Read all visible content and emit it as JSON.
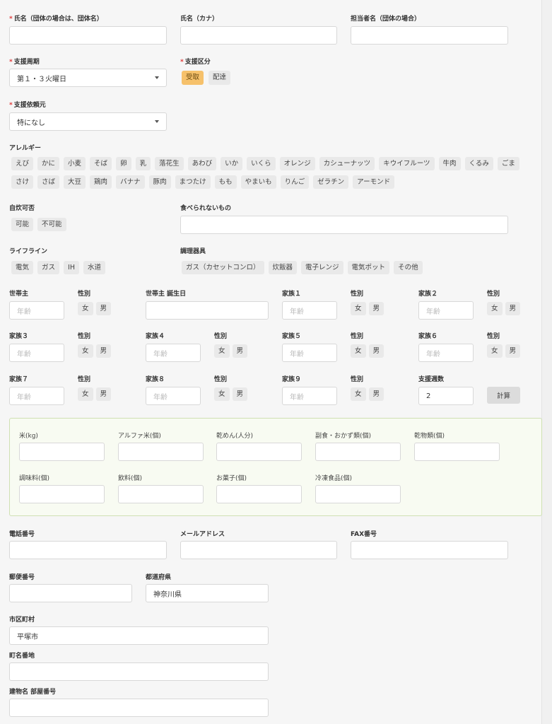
{
  "name": {
    "label": "氏名（団体の場合は、団体名）",
    "required": true,
    "value": ""
  },
  "kana": {
    "label": "氏名（カナ）",
    "value": ""
  },
  "contact": {
    "label": "担当者名（団体の場合）",
    "value": ""
  },
  "period": {
    "label": "支援周期",
    "required": true,
    "value": "第１・３火曜日"
  },
  "category": {
    "label": "支援区分",
    "required": true,
    "options": [
      "受取",
      "配達"
    ],
    "selected": "受取"
  },
  "requester": {
    "label": "支援依頼元",
    "required": true,
    "value": "特になし"
  },
  "allergy": {
    "label": "アレルギー",
    "row1": [
      "えび",
      "かに",
      "小麦",
      "そば",
      "卵",
      "乳",
      "落花生",
      "あわび",
      "いか",
      "いくら",
      "オレンジ",
      "カシューナッツ",
      "キウイフルーツ",
      "牛肉",
      "くるみ",
      "ごま"
    ],
    "row2": [
      "さけ",
      "さば",
      "大豆",
      "鶏肉",
      "バナナ",
      "豚肉",
      "まつたけ",
      "もも",
      "やまいも",
      "りんご",
      "ゼラチン",
      "アーモンド"
    ]
  },
  "selfcook": {
    "label": "自炊可否",
    "options": [
      "可能",
      "不可能"
    ]
  },
  "cannot_eat": {
    "label": "食べられないもの",
    "value": ""
  },
  "lifeline": {
    "label": "ライフライン",
    "options": [
      "電気",
      "ガス",
      "IH",
      "水道"
    ]
  },
  "utensils": {
    "label": "調理器具",
    "options": [
      "ガス（カセットコンロ）",
      "炊飯器",
      "電子レンジ",
      "電気ポット",
      "その他"
    ]
  },
  "household": {
    "age_placeholder": "年齢",
    "gender_label": "性別",
    "female": "女",
    "male": "男",
    "head": "世帯主",
    "head_birthday": "世帯主 誕生日",
    "members": [
      "家族１",
      "家族２",
      "家族３",
      "家族４",
      "家族５",
      "家族６",
      "家族７",
      "家族８",
      "家族９"
    ],
    "weeks_label": "支援週数",
    "weeks_value": "2",
    "calc_button": "計算"
  },
  "food": {
    "items": [
      "米(kg)",
      "アルファ米(個)",
      "乾めん(人分)",
      "副食・おかず類(個)",
      "乾物類(個)",
      "調味料(個)",
      "飲料(個)",
      "お菓子(個)",
      "冷凍食品(個)"
    ]
  },
  "phone": {
    "label": "電話番号",
    "value": ""
  },
  "email": {
    "label": "メールアドレス",
    "value": ""
  },
  "fax": {
    "label": "FAX番号",
    "value": ""
  },
  "postal": {
    "label": "郵便番号",
    "value": ""
  },
  "prefecture": {
    "label": "都道府県",
    "value": "神奈川県"
  },
  "city": {
    "label": "市区町村",
    "value": "平塚市"
  },
  "street": {
    "label": "町名番地",
    "value": ""
  },
  "building": {
    "label": "建物名 部屋番号",
    "value": ""
  },
  "colors": {
    "accent_chip": "#f6c16b",
    "required_mark": "#e03a3a",
    "green_box_border": "#cfe0b3"
  }
}
